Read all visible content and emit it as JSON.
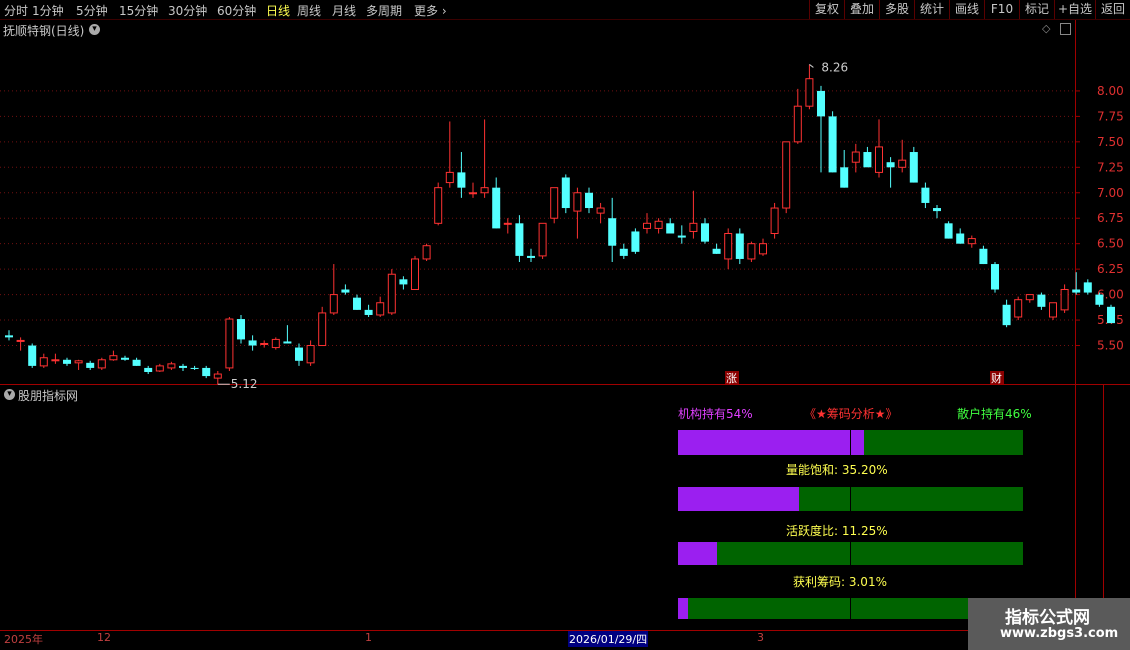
{
  "toolbar": {
    "periods": [
      "分时",
      "1分钟",
      "5分钟",
      "15分钟",
      "30分钟",
      "60分钟",
      "日线",
      "周线",
      "月线",
      "多周期",
      "更多"
    ],
    "active": "日线",
    "right_buttons": [
      "复权",
      "叠加",
      "多股",
      "统计",
      "画线",
      "F10",
      "标记",
      "+自选",
      "返回"
    ]
  },
  "stock": {
    "title": "抚顺特钢(日线)"
  },
  "chart_data": {
    "type": "candlestick",
    "y_ticks": [
      "8.00",
      "7.75",
      "7.50",
      "7.25",
      "7.00",
      "6.75",
      "6.50",
      "6.25",
      "6.00",
      "5.75",
      "5.50"
    ],
    "ylim": [
      5.24,
      8.5
    ],
    "high_label": "8.26",
    "low_label": "5.12",
    "x_labels": [
      "2025年",
      "12",
      "1",
      "2026/01/29/四",
      "3"
    ],
    "markers": [
      "涨",
      "财"
    ],
    "ohlc": [
      [
        5.6,
        5.65,
        5.55,
        5.58
      ],
      [
        5.55,
        5.58,
        5.45,
        5.55
      ],
      [
        5.5,
        5.52,
        5.28,
        5.3
      ],
      [
        5.3,
        5.42,
        5.28,
        5.38
      ],
      [
        5.35,
        5.42,
        5.32,
        5.36
      ],
      [
        5.36,
        5.38,
        5.3,
        5.32
      ],
      [
        5.33,
        5.36,
        5.26,
        5.35
      ],
      [
        5.33,
        5.35,
        5.26,
        5.28
      ],
      [
        5.28,
        5.38,
        5.26,
        5.36
      ],
      [
        5.36,
        5.45,
        5.35,
        5.4
      ],
      [
        5.38,
        5.4,
        5.35,
        5.36
      ],
      [
        5.36,
        5.38,
        5.3,
        5.3
      ],
      [
        5.28,
        5.3,
        5.22,
        5.24
      ],
      [
        5.25,
        5.32,
        5.24,
        5.3
      ],
      [
        5.28,
        5.34,
        5.26,
        5.32
      ],
      [
        5.3,
        5.32,
        5.25,
        5.28
      ],
      [
        5.28,
        5.3,
        5.26,
        5.27
      ],
      [
        5.28,
        5.3,
        5.18,
        5.2
      ],
      [
        5.18,
        5.25,
        5.12,
        5.22
      ],
      [
        5.28,
        5.78,
        5.25,
        5.76
      ],
      [
        5.76,
        5.8,
        5.52,
        5.56
      ],
      [
        5.55,
        5.6,
        5.45,
        5.5
      ],
      [
        5.52,
        5.55,
        5.48,
        5.52
      ],
      [
        5.48,
        5.58,
        5.46,
        5.56
      ],
      [
        5.54,
        5.7,
        5.52,
        5.52
      ],
      [
        5.48,
        5.52,
        5.3,
        5.35
      ],
      [
        5.33,
        5.55,
        5.3,
        5.5
      ],
      [
        5.5,
        5.88,
        5.5,
        5.82
      ],
      [
        5.82,
        6.3,
        5.8,
        6.0
      ],
      [
        6.05,
        6.1,
        6.0,
        6.02
      ],
      [
        5.97,
        6.0,
        5.85,
        5.85
      ],
      [
        5.85,
        5.9,
        5.78,
        5.8
      ],
      [
        5.8,
        5.98,
        5.78,
        5.92
      ],
      [
        5.82,
        6.25,
        5.8,
        6.2
      ],
      [
        6.15,
        6.18,
        6.05,
        6.1
      ],
      [
        6.05,
        6.38,
        6.05,
        6.35
      ],
      [
        6.35,
        6.5,
        6.33,
        6.48
      ],
      [
        6.7,
        7.1,
        6.68,
        7.05
      ],
      [
        7.1,
        7.7,
        7.05,
        7.2
      ],
      [
        7.2,
        7.4,
        6.95,
        7.05
      ],
      [
        7.0,
        7.1,
        6.95,
        7.0
      ],
      [
        7.0,
        7.72,
        6.95,
        7.05
      ],
      [
        7.05,
        7.15,
        6.65,
        6.65
      ],
      [
        6.7,
        6.75,
        6.6,
        6.7
      ],
      [
        6.7,
        6.78,
        6.32,
        6.38
      ],
      [
        6.38,
        6.45,
        6.32,
        6.36
      ],
      [
        6.38,
        6.7,
        6.35,
        6.7
      ],
      [
        6.75,
        7.05,
        6.7,
        7.05
      ],
      [
        7.15,
        7.18,
        6.8,
        6.85
      ],
      [
        6.82,
        7.05,
        6.55,
        7.0
      ],
      [
        7.0,
        7.05,
        6.8,
        6.85
      ],
      [
        6.8,
        6.9,
        6.7,
        6.85
      ],
      [
        6.75,
        6.95,
        6.32,
        6.48
      ],
      [
        6.45,
        6.5,
        6.35,
        6.38
      ],
      [
        6.62,
        6.65,
        6.4,
        6.42
      ],
      [
        6.65,
        6.8,
        6.6,
        6.7
      ],
      [
        6.65,
        6.75,
        6.6,
        6.72
      ],
      [
        6.7,
        6.75,
        6.6,
        6.6
      ],
      [
        6.58,
        6.68,
        6.5,
        6.56
      ],
      [
        6.62,
        7.02,
        6.55,
        6.7
      ],
      [
        6.7,
        6.75,
        6.5,
        6.52
      ],
      [
        6.45,
        6.5,
        6.4,
        6.4
      ],
      [
        6.35,
        6.65,
        6.25,
        6.6
      ],
      [
        6.6,
        6.65,
        6.3,
        6.35
      ],
      [
        6.35,
        6.52,
        6.32,
        6.5
      ],
      [
        6.4,
        6.55,
        6.38,
        6.5
      ],
      [
        6.6,
        6.9,
        6.55,
        6.85
      ],
      [
        6.85,
        7.5,
        6.8,
        7.5
      ],
      [
        7.5,
        8.02,
        7.48,
        7.85
      ],
      [
        7.85,
        8.26,
        7.82,
        8.12
      ],
      [
        8.0,
        8.05,
        7.2,
        7.75
      ],
      [
        7.75,
        7.8,
        7.2,
        7.2
      ],
      [
        7.25,
        7.42,
        7.05,
        7.05
      ],
      [
        7.3,
        7.48,
        7.2,
        7.4
      ],
      [
        7.4,
        7.45,
        7.28,
        7.25
      ],
      [
        7.2,
        7.72,
        7.15,
        7.45
      ],
      [
        7.3,
        7.35,
        7.05,
        7.25
      ],
      [
        7.25,
        7.52,
        7.2,
        7.32
      ],
      [
        7.4,
        7.45,
        7.1,
        7.1
      ],
      [
        7.05,
        7.1,
        6.85,
        6.9
      ],
      [
        6.85,
        6.88,
        6.75,
        6.82
      ],
      [
        6.7,
        6.72,
        6.55,
        6.55
      ],
      [
        6.6,
        6.65,
        6.5,
        6.5
      ],
      [
        6.5,
        6.58,
        6.46,
        6.55
      ],
      [
        6.45,
        6.48,
        6.3,
        6.3
      ],
      [
        6.3,
        6.32,
        6.02,
        6.05
      ],
      [
        5.9,
        5.95,
        5.68,
        5.7
      ],
      [
        5.78,
        5.98,
        5.75,
        5.95
      ],
      [
        5.95,
        6.0,
        5.92,
        6.0
      ],
      [
        6.0,
        6.02,
        5.85,
        5.88
      ],
      [
        5.78,
        5.92,
        5.75,
        5.92
      ],
      [
        5.85,
        6.1,
        5.82,
        6.05
      ],
      [
        6.05,
        6.22,
        6.0,
        6.02
      ],
      [
        6.12,
        6.15,
        6.0,
        6.02
      ],
      [
        6.0,
        6.02,
        5.88,
        5.9
      ],
      [
        5.88,
        5.9,
        5.72,
        5.72
      ]
    ]
  },
  "indicator": {
    "panel_title": "股朋指标网",
    "inst_label": "机构持有54%",
    "retail_label": "散户持有46%",
    "analysis_label": "《★筹码分析★》",
    "rows": [
      {
        "label": "量能饱和:  35.20%",
        "fill": 0.352
      },
      {
        "label": "活跃度比:  11.25%",
        "fill": 0.1125
      },
      {
        "label": "获利筹码:  3.01%",
        "fill": 0.0301
      }
    ],
    "top_fill": 0.54
  },
  "watermark": {
    "line1": "指标公式网",
    "line2": "www.zbgs3.com"
  },
  "colors": {
    "up": "#ff3232",
    "down": "#54ffff",
    "purple": "#9b1ff0",
    "green": "#006400"
  }
}
